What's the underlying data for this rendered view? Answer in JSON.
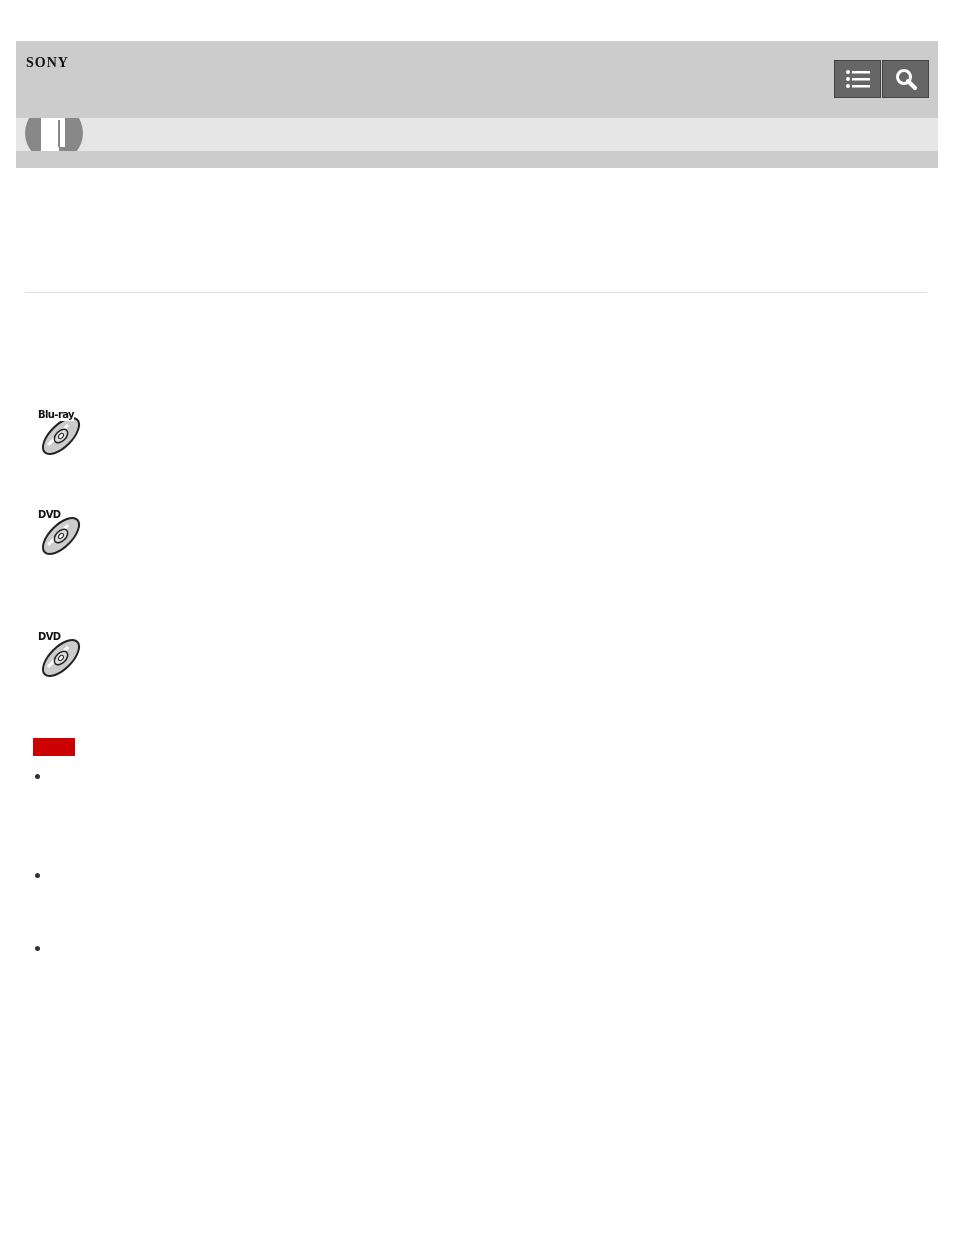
{
  "header": {
    "logo": "SONY"
  },
  "discs": [
    {
      "label": "Blu-ray"
    },
    {
      "label": "DVD"
    },
    {
      "label": "DVD"
    }
  ],
  "notes": [
    {
      "kind": "bullet"
    },
    {
      "kind": "bullet"
    },
    {
      "kind": "bullet"
    }
  ]
}
